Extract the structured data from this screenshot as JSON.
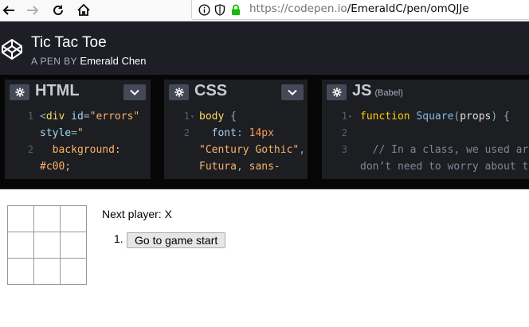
{
  "browser": {
    "url_host": "https://codepen.io",
    "url_path": "/EmeraldC/pen/omQJJe"
  },
  "pen": {
    "title": "Tic Tac Toe",
    "byline": "A PEN BY",
    "author": "Emerald Chen"
  },
  "editors": {
    "html": {
      "title": "HTML",
      "line_numbers": [
        "1",
        "2"
      ],
      "lines": [
        "<div id=\"errors\"",
        "style=\"",
        "  background:",
        "#c00;"
      ]
    },
    "css": {
      "title": "CSS",
      "line_numbers": [
        "1",
        "2"
      ],
      "lines": [
        "body {",
        "  font: 14px",
        "\"Century Gothic\",",
        "Futura, sans-"
      ]
    },
    "js": {
      "title": "JS",
      "subtitle": "(Babel)",
      "line_numbers": [
        "1",
        "2",
        "3"
      ],
      "lines": [
        "function Square(props) {",
        "  // In a class, we used ar",
        "don’t need to worry about t"
      ]
    }
  },
  "game": {
    "status": "Next player: X",
    "moves": [
      {
        "number": "1.",
        "label": "Go to game start"
      }
    ]
  },
  "colors": {
    "codepen_header": "#1e1f26",
    "editor_bg": "#1d1e22",
    "lock_green": "#12bc00"
  }
}
